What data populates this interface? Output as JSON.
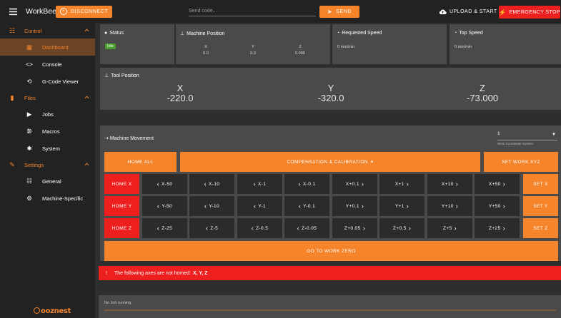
{
  "topbar": {
    "title": "WorkBee",
    "disconnect_label": "DISCONNECT",
    "send_placeholder": "Send code...",
    "send_label": "SEND",
    "upload_label": "UPLOAD & START",
    "estop_label": "EMERGENCY STOP"
  },
  "sidebar": {
    "control": "Control",
    "dashboard": "Dashboard",
    "console": "Console",
    "gcode_viewer": "G-Code Viewer",
    "files": "Files",
    "jobs": "Jobs",
    "macros": "Macros",
    "system": "System",
    "settings": "Settings",
    "general": "General",
    "machine_specific": "Machine-Specific",
    "brand": "ooznest"
  },
  "status": {
    "title": "Status",
    "state": "Idle"
  },
  "machine_position": {
    "title": "Machine Position",
    "axes": [
      {
        "label": "X",
        "value": "0.0"
      },
      {
        "label": "Y",
        "value": "0.0"
      },
      {
        "label": "Z",
        "value": "0.000"
      }
    ]
  },
  "requested_speed": {
    "title": "Requested Speed",
    "value": "0 mm/min"
  },
  "top_speed": {
    "title": "Top Speed",
    "value": "0 mm/min"
  },
  "tool_position": {
    "title": "Tool Position",
    "axes": [
      {
        "label": "X",
        "value": "-220.0"
      },
      {
        "label": "Y",
        "value": "-320.0"
      },
      {
        "label": "Z",
        "value": "-73.000"
      }
    ]
  },
  "movement": {
    "title": "Machine Movement",
    "wcs_value": "1",
    "wcs_label": "Work Coordinate System",
    "home_all": "HOME ALL",
    "compensation": "COMPENSATION & CALIBRATION",
    "set_work_xyz": "SET WORK XYZ",
    "go_to_work_zero": "GO TO WORK ZERO",
    "rows": [
      {
        "home": "HOME X",
        "set": "SET X",
        "jogs": [
          "X-50",
          "X-10",
          "X-1",
          "X-0.1",
          "X+0.1",
          "X+1",
          "X+10",
          "X+50"
        ]
      },
      {
        "home": "HOME Y",
        "set": "SET Y",
        "jogs": [
          "Y-50",
          "Y-10",
          "Y-1",
          "Y-0.1",
          "Y+0.1",
          "Y+1",
          "Y+10",
          "Y+50"
        ]
      },
      {
        "home": "HOME Z",
        "set": "SET Z",
        "jogs": [
          "Z-25",
          "Z-5",
          "Z-0.5",
          "Z-0.05",
          "Z+0.05",
          "Z+0.5",
          "Z+5",
          "Z+25"
        ]
      }
    ]
  },
  "alert": {
    "prefix": "The following axes are not homed:",
    "axes": "X, Y, Z"
  },
  "job": {
    "status": "No Job running."
  },
  "colors": {
    "accent": "#f6842a",
    "danger": "#ee1f1f",
    "panel": "#4a4a4a",
    "background": "#2e2e2e"
  }
}
